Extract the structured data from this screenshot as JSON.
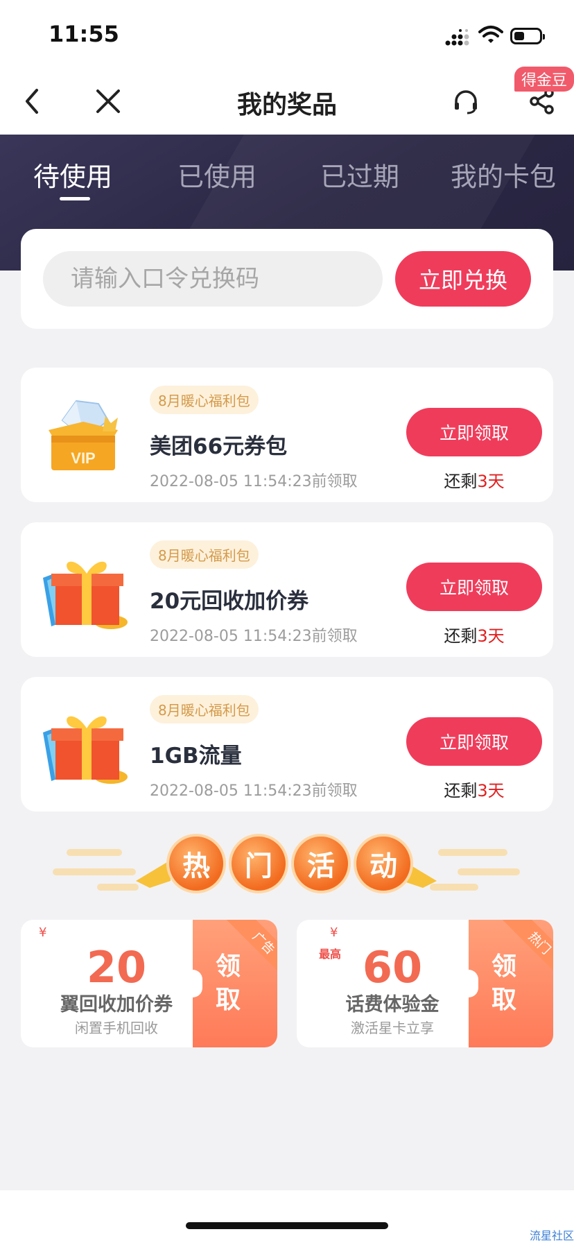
{
  "status_bar": {
    "time": "11:55"
  },
  "nav": {
    "title": "我的奖品",
    "share_badge": "得金豆",
    "icons": {
      "back": "chevron-left-icon",
      "close": "close-icon",
      "service": "headset-icon",
      "share": "share-icon"
    }
  },
  "tabs": [
    {
      "label": "待使用",
      "active": true
    },
    {
      "label": "已使用",
      "active": false
    },
    {
      "label": "已过期",
      "active": false
    },
    {
      "label": "我的卡包",
      "active": false
    }
  ],
  "redeem": {
    "placeholder": "请输入口令兑换码",
    "button": "立即兑换"
  },
  "prizes": [
    {
      "tag": "8月暖心福利包",
      "title": "美团66元券包",
      "deadline": "2022-08-05 11:54:23前领取",
      "button": "立即领取",
      "remain_prefix": "还剩",
      "remain_days": "3天",
      "icon": "vip-crown-icon"
    },
    {
      "tag": "8月暖心福利包",
      "title": "20元回收加价券",
      "deadline": "2022-08-05 11:54:23前领取",
      "button": "立即领取",
      "remain_prefix": "还剩",
      "remain_days": "3天",
      "icon": "gift-box-icon"
    },
    {
      "tag": "8月暖心福利包",
      "title": "1GB流量",
      "deadline": "2022-08-05 11:54:23前领取",
      "button": "立即领取",
      "remain_prefix": "还剩",
      "remain_days": "3天",
      "icon": "gift-box-icon"
    }
  ],
  "hot_section": {
    "chars": [
      "热",
      "门",
      "活",
      "动"
    ]
  },
  "promos": [
    {
      "currency": "¥",
      "max_label": "",
      "amount": "20",
      "title": "翼回收加价券",
      "subtitle": "闲置手机回收",
      "cta": "领取",
      "ribbon": "广告"
    },
    {
      "currency": "¥",
      "max_label": "最高",
      "amount": "60",
      "title": "话费体验金",
      "subtitle": "激活星卡立享",
      "cta": "领取",
      "ribbon": "热门"
    }
  ],
  "watermark": "流星社区"
}
